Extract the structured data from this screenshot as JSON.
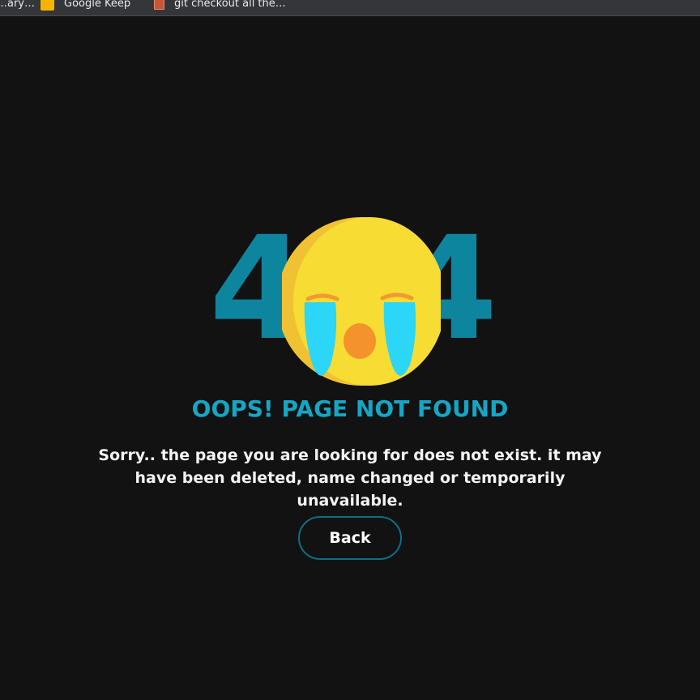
{
  "bookmarks": [
    {
      "label": "…ary…",
      "icon": "partial-bookmark"
    },
    {
      "label": "Google Keep",
      "icon": "keep-icon"
    },
    {
      "label": "git checkout all the…",
      "icon": "document-icon"
    }
  ],
  "error": {
    "digit_left": "4",
    "digit_right": "4",
    "title": "OOPS! PAGE NOT FOUND",
    "message": "Sorry.. the page you are looking for does not exist. it may have been deleted, name changed or temporarily unavailable.",
    "back_label": "Back"
  },
  "colors": {
    "background": "#121213",
    "digits": "#0e859e",
    "title": "#15a6c4",
    "emoji_face": "#f7dc33",
    "emoji_shade": "#f0c233",
    "tears": "#2bd6f7",
    "mouth": "#f4922b",
    "button_border": "#0e6f84"
  }
}
